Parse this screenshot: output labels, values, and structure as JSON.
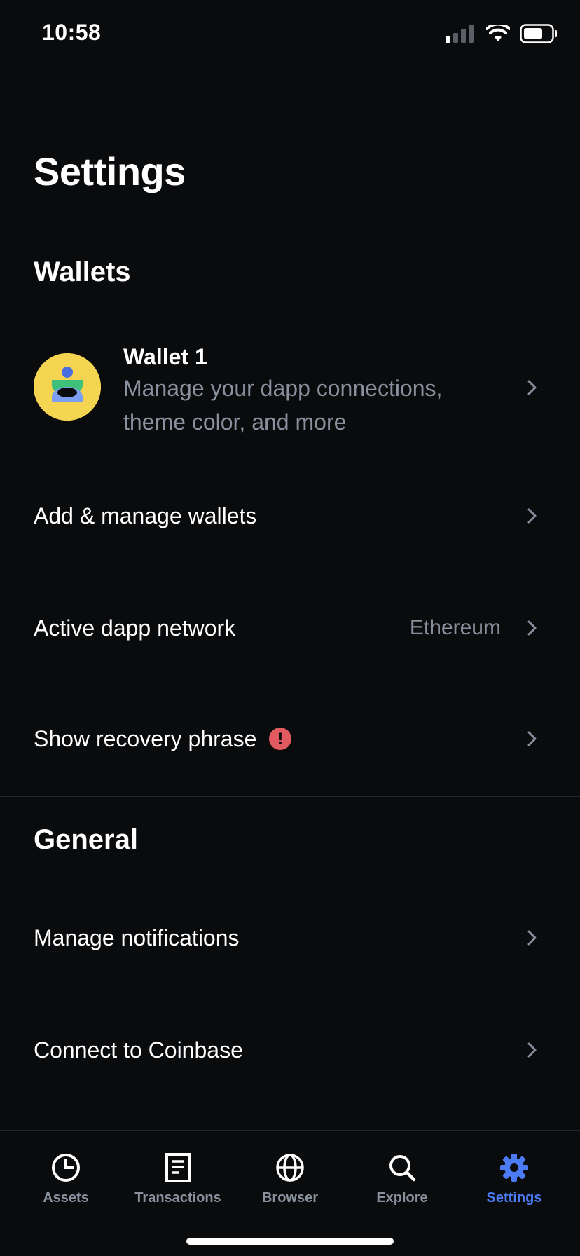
{
  "status_bar": {
    "time": "10:58"
  },
  "page": {
    "title": "Settings"
  },
  "sections": {
    "wallets": {
      "title": "Wallets"
    },
    "general": {
      "title": "General"
    }
  },
  "wallet": {
    "name": "Wallet 1",
    "description": "Manage your dapp connections, theme color, and more",
    "avatar_color": "#f4d451"
  },
  "rows": {
    "add_manage": {
      "label": "Add & manage wallets"
    },
    "active_network": {
      "label": "Active dapp network",
      "value": "Ethereum"
    },
    "recovery": {
      "label": "Show recovery phrase",
      "badge": "!",
      "badge_color": "#e05a5f"
    },
    "notifications": {
      "label": "Manage notifications"
    },
    "coinbase": {
      "label": "Connect to Coinbase"
    }
  },
  "tabs": [
    {
      "label": "Assets",
      "icon": "pie-chart-icon",
      "active": false
    },
    {
      "label": "Transactions",
      "icon": "document-icon",
      "active": false
    },
    {
      "label": "Browser",
      "icon": "globe-icon",
      "active": false
    },
    {
      "label": "Explore",
      "icon": "search-icon",
      "active": false
    },
    {
      "label": "Settings",
      "icon": "gear-icon",
      "active": true
    }
  ],
  "colors": {
    "background": "#0a0b0d",
    "accent": "#4c7cf5",
    "muted_text": "#8a919e",
    "divider": "#24262b"
  }
}
